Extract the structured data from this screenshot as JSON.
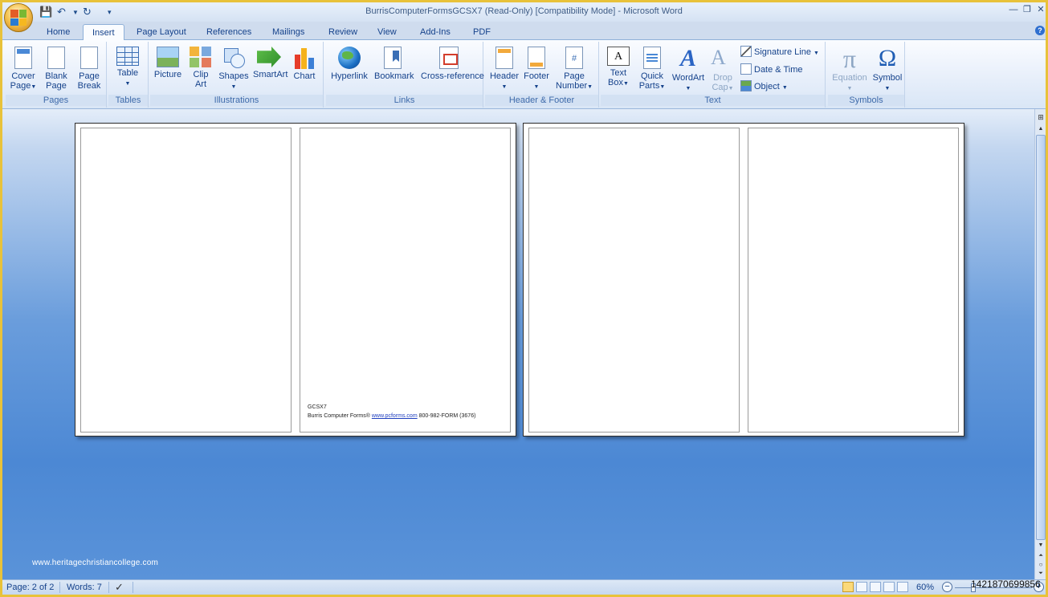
{
  "window": {
    "title": "BurrisComputerFormsGCSX7 (Read-Only) [Compatibility Mode] - Microsoft Word"
  },
  "tabs": [
    {
      "label": "Home"
    },
    {
      "label": "Insert"
    },
    {
      "label": "Page Layout"
    },
    {
      "label": "References"
    },
    {
      "label": "Mailings"
    },
    {
      "label": "Review"
    },
    {
      "label": "View"
    },
    {
      "label": "Add-Ins"
    },
    {
      "label": "PDF"
    }
  ],
  "active_tab": "Insert",
  "ribbon": {
    "pages": {
      "label": "Pages",
      "cover_page": {
        "line1": "Cover",
        "line2": "Page"
      },
      "blank_page": {
        "line1": "Blank",
        "line2": "Page"
      },
      "page_break": {
        "line1": "Page",
        "line2": "Break"
      }
    },
    "tables": {
      "label": "Tables",
      "table": {
        "line1": "Table"
      }
    },
    "illustrations": {
      "label": "Illustrations",
      "picture": {
        "line1": "Picture"
      },
      "clip_art": {
        "line1": "Clip",
        "line2": "Art"
      },
      "shapes": {
        "line1": "Shapes"
      },
      "smartart": {
        "line1": "SmartArt"
      },
      "chart": {
        "line1": "Chart"
      }
    },
    "links": {
      "label": "Links",
      "hyperlink": {
        "line1": "Hyperlink"
      },
      "bookmark": {
        "line1": "Bookmark"
      },
      "cross_reference": {
        "line1": "Cross-reference"
      }
    },
    "header_footer": {
      "label": "Header & Footer",
      "header": {
        "line1": "Header"
      },
      "footer": {
        "line1": "Footer"
      },
      "page_number": {
        "line1": "Page",
        "line2": "Number",
        "icon_text": "#"
      }
    },
    "text": {
      "label": "Text",
      "text_box": {
        "line1": "Text",
        "line2": "Box",
        "icon_text": "A"
      },
      "quick_parts": {
        "line1": "Quick",
        "line2": "Parts"
      },
      "wordart": {
        "line1": "WordArt",
        "icon_text": "A"
      },
      "drop_cap": {
        "line1": "Drop",
        "line2": "Cap",
        "icon_text": "A"
      },
      "signature_line": "Signature Line",
      "date_time": "Date & Time",
      "object": "Object"
    },
    "symbols": {
      "label": "Symbols",
      "equation": {
        "line1": "Equation",
        "icon_text": "π"
      },
      "symbol": {
        "line1": "Symbol",
        "icon_text": "Ω"
      }
    }
  },
  "document": {
    "footer_code": "GCSX7",
    "footer_company": "Burris Computer Forms®",
    "footer_link": "www.pcforms.com",
    "footer_phone": "800-982-FORM (3676)"
  },
  "watermark": "www.heritagechristiancollege.com",
  "statusbar": {
    "page": "Page: 2 of 2",
    "words": "Words: 7",
    "zoom": "60%",
    "zoom_out": "−",
    "zoom_in": "+"
  },
  "image_id": "1421870699856"
}
